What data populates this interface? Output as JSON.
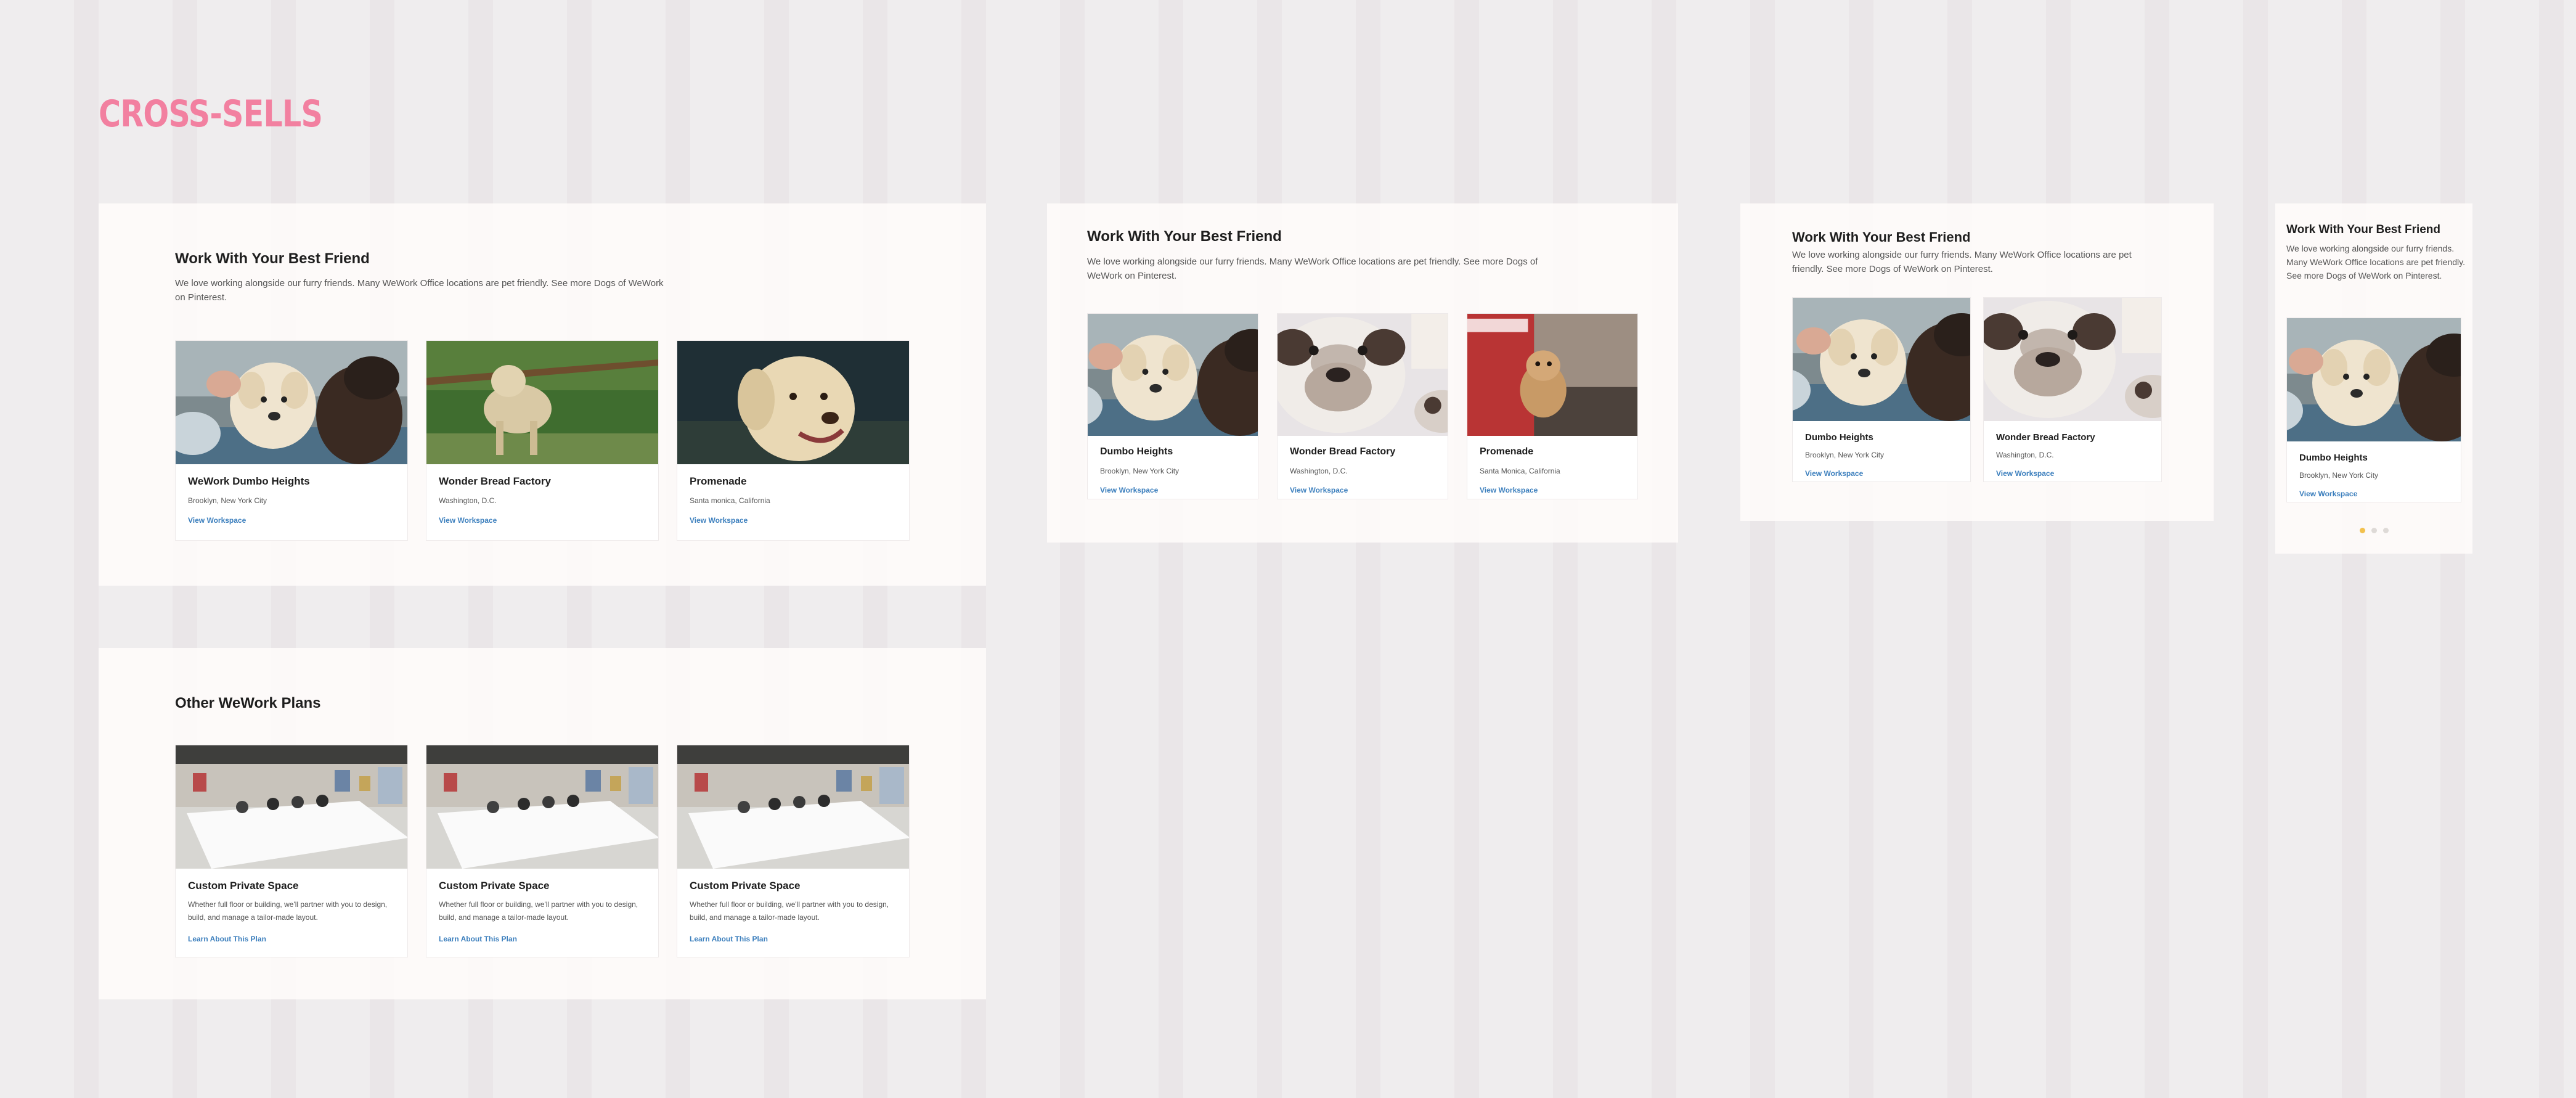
{
  "page": {
    "title": "CROSS-SELLS"
  },
  "pets": {
    "heading": "Work With Your Best Friend",
    "description": "We love working alongside our furry friends. Many WeWork Office locations are pet friendly. See more Dogs of WeWork on Pinterest.",
    "link_label": "View Workspace",
    "cards_large": [
      {
        "title": "WeWork Dumbo Heights",
        "location": "Brooklyn, New York City"
      },
      {
        "title": "Wonder Bread Factory",
        "location": "Washington, D.C."
      },
      {
        "title": "Promenade",
        "location": "Santa monica, California"
      }
    ],
    "cards_small": [
      {
        "title": "Dumbo Heights",
        "location": "Brooklyn, New York City"
      },
      {
        "title": "Wonder Bread Factory",
        "location": "Washington, D.C."
      },
      {
        "title": "Promenade",
        "location": "Santa Monica, California"
      }
    ]
  },
  "plans": {
    "heading": "Other WeWork Plans",
    "link_label": "Learn About This Plan",
    "cards": [
      {
        "title": "Custom Private Space",
        "description": "Whether full floor or building, we'll partner with you to design, build, and manage a tailor-made layout."
      },
      {
        "title": "Custom Private Space",
        "description": "Whether full floor or building, we'll partner with you to design, build, and manage a tailor-made layout."
      },
      {
        "title": "Custom Private Space",
        "description": "Whether full floor or building, we'll partner with you to design, build, and manage a tailor-made layout."
      }
    ]
  },
  "colors": {
    "title_pink": "#f280a0",
    "link_blue": "#3c7fbd",
    "carousel_active": "#f2c14e"
  },
  "carousel": {
    "pages": 3,
    "active": 1
  }
}
